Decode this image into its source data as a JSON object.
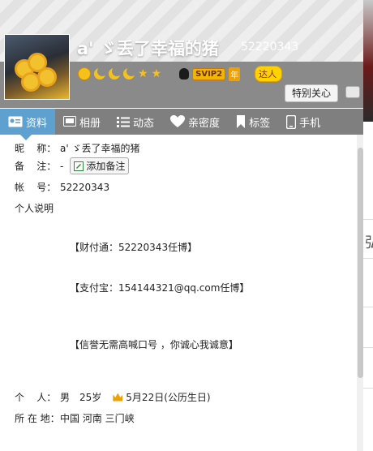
{
  "profile": {
    "display_name": "a' ゞ丢了幸福的猪",
    "qq_number": "52220343",
    "badges": {
      "svip": "SVIP2",
      "year": "年",
      "daren": "达人"
    },
    "care_button": "特别关心"
  },
  "tabs": [
    {
      "label": "资料",
      "icon": "profile-card-icon",
      "active": true
    },
    {
      "label": "相册",
      "icon": "photo-album-icon",
      "active": false
    },
    {
      "label": "动态",
      "icon": "feed-list-icon",
      "active": false
    },
    {
      "label": "亲密度",
      "icon": "heart-icon",
      "active": false
    },
    {
      "label": "标签",
      "icon": "bookmark-tag-icon",
      "active": false
    },
    {
      "label": "手机",
      "icon": "mobile-phone-icon",
      "active": false
    }
  ],
  "info": {
    "nickname_label": "昵    称：",
    "nickname": "a' ゞ丢了幸福的猪",
    "remark_label": "备    注：",
    "remark": "-",
    "add_remark": "添加备注",
    "account_label": "帐    号：",
    "account": "52220343",
    "personal_desc_label": "个人说明",
    "desc_lines": [
      "【财付通：52220343任博】",
      "【支付宝：154144321@qq.com任博】",
      "【信誉无需高喊口号 ，你诚心我诚意】"
    ],
    "personal_label": "个    人：",
    "gender": "男",
    "age": "25岁",
    "birthday": "5月22日(公历生日)",
    "location_label": "所 在 地：",
    "location": "中国 河南 三门峡"
  },
  "side_window": {
    "partial_char": "弘"
  },
  "colors": {
    "tab_bar": "#7f7f7f",
    "tab_active": "#5ea0d0",
    "header_shade": "#8a8a8a"
  }
}
